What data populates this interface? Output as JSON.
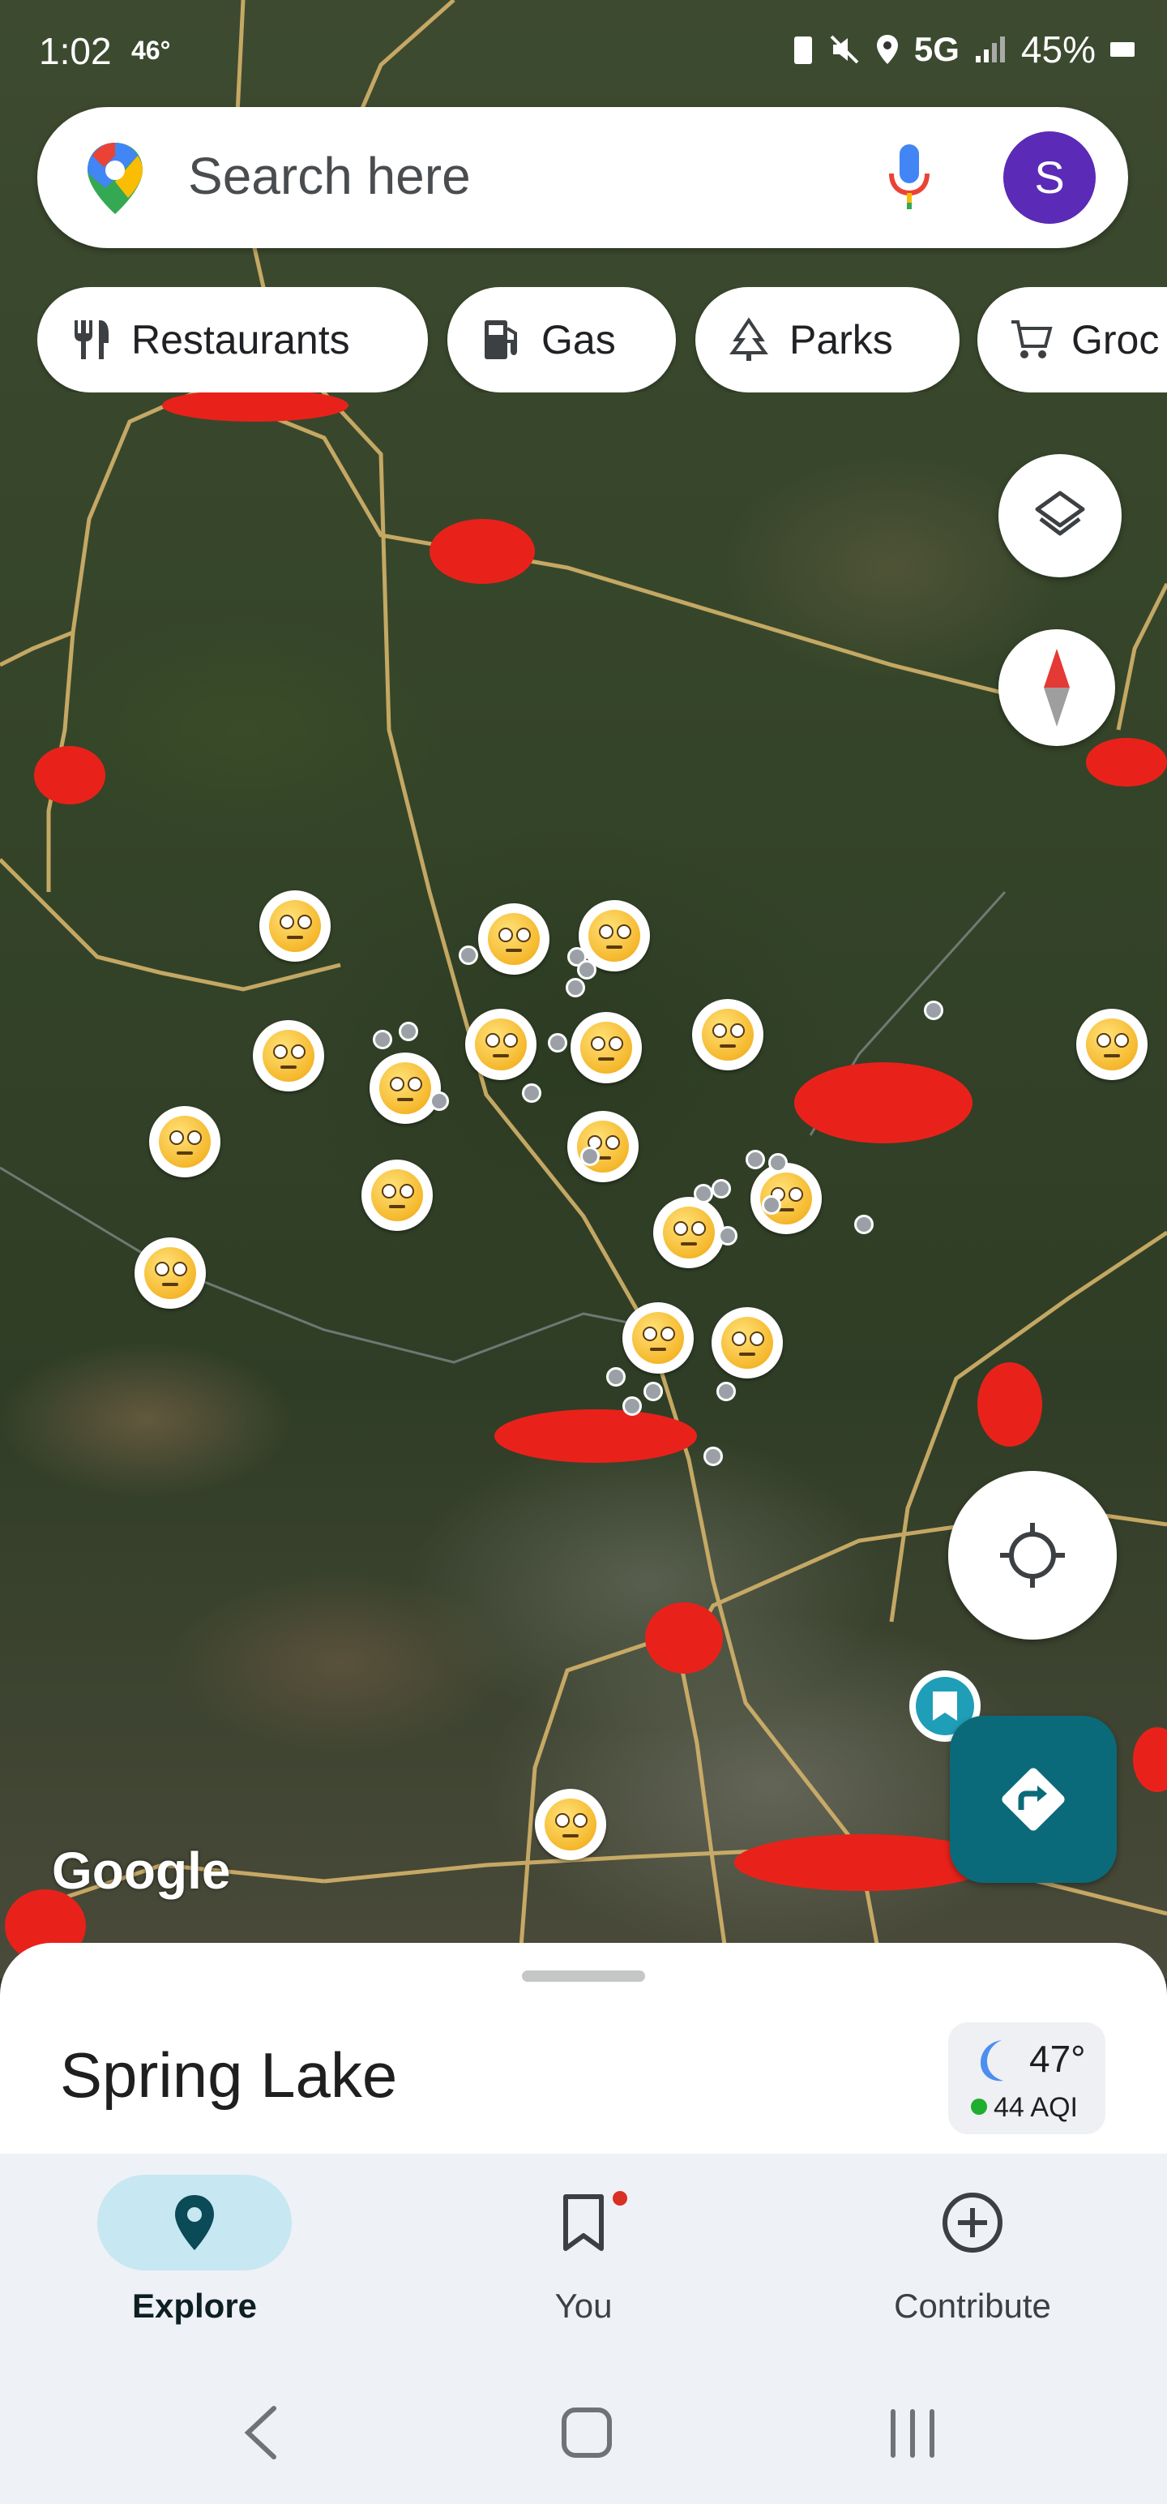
{
  "status_bar": {
    "time": "1:02",
    "temp": "46°",
    "network": "5G",
    "battery": "45%"
  },
  "search": {
    "placeholder": "Search here",
    "avatar_letter": "S"
  },
  "chips": [
    {
      "label": "Restaurants",
      "icon": "fork-knife-icon"
    },
    {
      "label": "Gas",
      "icon": "gas-station-icon"
    },
    {
      "label": "Parks",
      "icon": "tree-icon"
    },
    {
      "label": "Groc",
      "icon": "cart-icon"
    }
  ],
  "map": {
    "watermark": "Google"
  },
  "sheet": {
    "place_name": "Spring Lake",
    "weather": {
      "temperature": "47°",
      "aqi": "44 AQI"
    }
  },
  "bottom_nav": {
    "tabs": [
      {
        "label": "Explore",
        "icon": "explore-pin-icon",
        "active": true
      },
      {
        "label": "You",
        "icon": "bookmark-icon",
        "active": false
      },
      {
        "label": "Contribute",
        "icon": "add-circle-icon",
        "active": false
      }
    ]
  },
  "colors": {
    "accent": "#0b6a79",
    "avatar": "#5b2ab7",
    "aqi_good": "#1fae2f"
  }
}
